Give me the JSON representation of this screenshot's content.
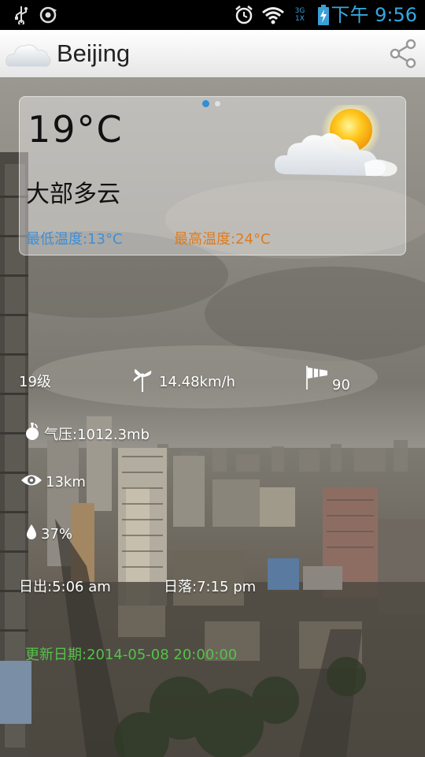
{
  "status_bar": {
    "time": "下午 9:56",
    "network_top": "3G",
    "network_bottom": "1X",
    "icons": [
      "usb-icon",
      "sync-icon",
      "alarm-icon",
      "wifi-icon",
      "network-icon",
      "battery-charging-icon"
    ]
  },
  "action_bar": {
    "city": "Beijing",
    "share_icon": "share-icon",
    "app_icon": "cloud-icon"
  },
  "card": {
    "current_temp": "19°C",
    "condition": "大部多云",
    "low_temp": "最低温度:13°C",
    "high_temp": "最高温度:24°C",
    "weather_icon": "partly-cloudy-icon",
    "page_indicator": {
      "pages": 2,
      "active": 1
    },
    "colors": {
      "low": "#3d8fd6",
      "high": "#e07b1e"
    }
  },
  "details": {
    "wind_level": "19级",
    "wind_speed": "14.48km/h",
    "wind_direction": "90",
    "pressure": "气压:1012.3mb",
    "visibility": "13km",
    "humidity": "37%",
    "sunrise": "日出:5:06 am",
    "sunset": "日落:7:15 pm"
  },
  "updated": "更新日期:2014-05-08 20:00:00",
  "colors": {
    "status_time": "#35a8e0",
    "updated": "#55c24a"
  }
}
